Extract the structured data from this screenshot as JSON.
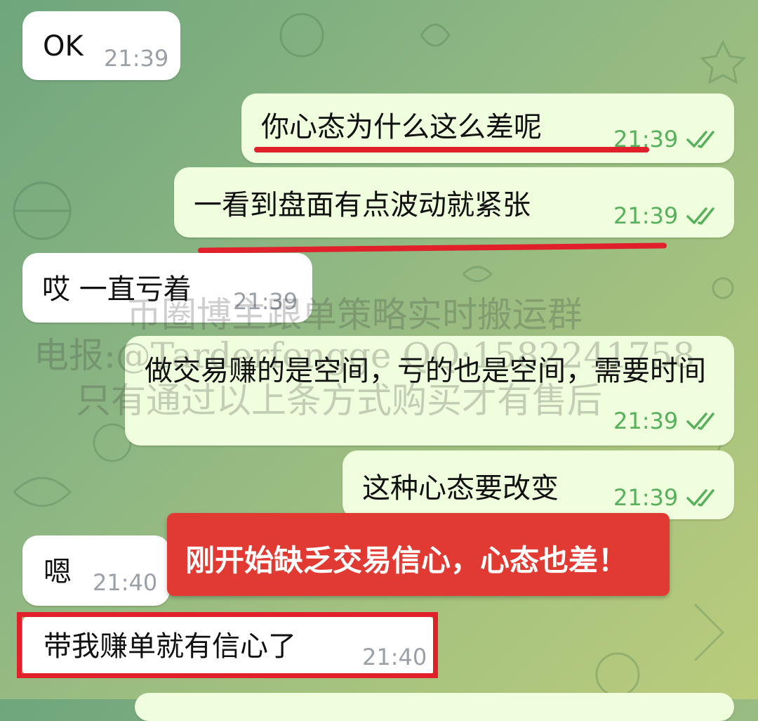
{
  "colors": {
    "incoming_bubble": "#ffffff",
    "outgoing_bubble": "#effedd",
    "outgoing_time": "#58b05c",
    "highlight_red": "#e0202a",
    "callout_bg": "#e13a33"
  },
  "messages": [
    {
      "dir": "in",
      "text": "OK",
      "time": "21:39"
    },
    {
      "dir": "out",
      "text": "你心态为什么这么差呢",
      "time": "21:39",
      "read": true
    },
    {
      "dir": "out",
      "text": "一看到盘面有点波动就紧张",
      "time": "21:39",
      "read": true
    },
    {
      "dir": "in",
      "text": "哎 一直亏着",
      "time": "21:39"
    },
    {
      "dir": "out",
      "text": "做交易赚的是空间，亏的也是空间，需要时间",
      "time": "21:39",
      "read": true
    },
    {
      "dir": "out",
      "text": "这种心态要改变",
      "time": "21:39",
      "read": true
    },
    {
      "dir": "in",
      "text": "嗯",
      "time": "21:40"
    },
    {
      "dir": "in",
      "text": "带我赚单就有信心了",
      "time": "21:40"
    }
  ],
  "callout": {
    "text": "刚开始缺乏交易信心，心态也差！"
  },
  "watermark": {
    "line1": "币圈博主跟单策略实时搬运群",
    "line2": "电报:@Tarderfengge QQ:1582241758",
    "line3": "只有通过以上条方式购买才有售后"
  },
  "icons": {
    "read_receipt": "double-check-icon"
  }
}
